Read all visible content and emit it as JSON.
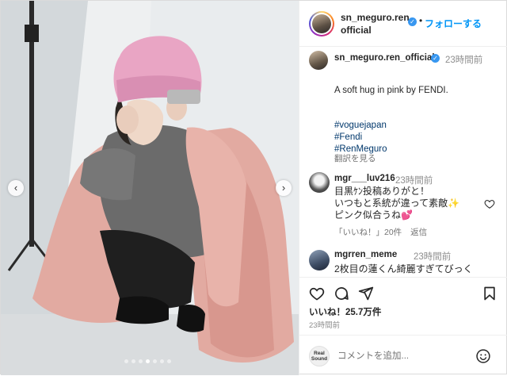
{
  "post": {
    "username_line1": "sn_meguro.ren_",
    "username_line2": "official",
    "follow_label": "フォローする",
    "dot_sep": "•"
  },
  "caption": {
    "username": "sn_meguro.ren_official",
    "time": "23時間前",
    "text": "A soft hug in pink by FENDI.",
    "hashtags": [
      "#voguejapan",
      "#Fendi",
      "#RenMeguro"
    ],
    "translate": "翻訳を見る"
  },
  "comments": [
    {
      "username": "mgr___luv216",
      "time": "23時間前",
      "lines": [
        "目黒ｹﾝ投稿ありがと！",
        "いつもと系統が違って素敵✨",
        "ピンク似合うね💕"
      ],
      "likes": "「いいね！」20件",
      "reply": "返信"
    },
    {
      "username": "mgrren_meme",
      "time": "23時間前",
      "lines": [
        "2枚目の蓮くん綺麗すぎてびっく"
      ]
    }
  ],
  "stats": {
    "likes": "いいね！25.7万件",
    "time": "23時間前"
  },
  "composer": {
    "placeholder": "コメントを追加...",
    "avatar_label_1": "Real",
    "avatar_label_2": "Sound"
  },
  "media": {
    "current_slide": 4,
    "total_slides": 7,
    "prev_arrow": "‹",
    "next_arrow": "›"
  },
  "icons": {
    "heart": "heart-icon",
    "comment": "comment-icon",
    "share": "share-icon",
    "save": "bookmark-icon",
    "emoji": "emoji-icon"
  },
  "colors": {
    "accent": "#0095f6",
    "verified": "#3897f0",
    "hashtag": "#00376b",
    "coat": "#e2aaa1",
    "beanie": "#e9a5c4"
  }
}
